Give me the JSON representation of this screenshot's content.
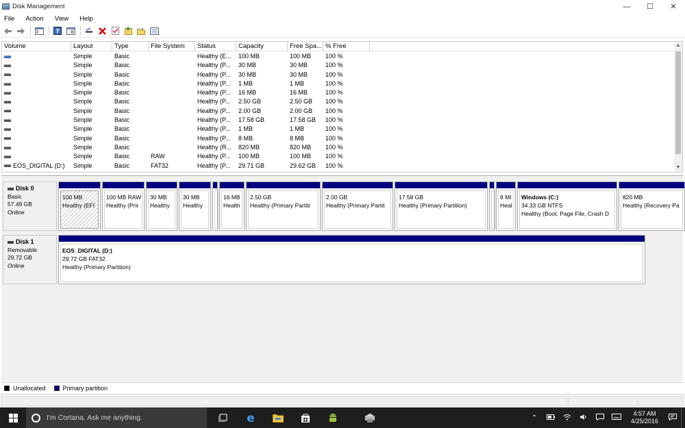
{
  "window": {
    "title": "Disk Management",
    "minimize": "—",
    "maximize": "☐",
    "close": "✕"
  },
  "menu": [
    "File",
    "Action",
    "View",
    "Help"
  ],
  "toolbar": [
    "back-icon",
    "forward-icon",
    "console-icon",
    "help-icon",
    "properties-icon",
    "connect-icon",
    "delete-icon",
    "check-icon",
    "new-icon",
    "folder-icon",
    "list-icon"
  ],
  "columns": [
    "Volume",
    "Layout",
    "Type",
    "File System",
    "Status",
    "Capacity",
    "Free Spa...",
    "% Free"
  ],
  "volumes": [
    {
      "name": "",
      "layout": "Simple",
      "type": "Basic",
      "fs": "",
      "status": "Healthy (E...",
      "capacity": "100 MB",
      "free": "100 MB",
      "pct": "100 %",
      "icon": "blue"
    },
    {
      "name": "",
      "layout": "Simple",
      "type": "Basic",
      "fs": "",
      "status": "Healthy (P...",
      "capacity": "30 MB",
      "free": "30 MB",
      "pct": "100 %",
      "icon": "gray"
    },
    {
      "name": "",
      "layout": "Simple",
      "type": "Basic",
      "fs": "",
      "status": "Healthy (P...",
      "capacity": "30 MB",
      "free": "30 MB",
      "pct": "100 %",
      "icon": "gray"
    },
    {
      "name": "",
      "layout": "Simple",
      "type": "Basic",
      "fs": "",
      "status": "Healthy (P...",
      "capacity": "1 MB",
      "free": "1 MB",
      "pct": "100 %",
      "icon": "gray"
    },
    {
      "name": "",
      "layout": "Simple",
      "type": "Basic",
      "fs": "",
      "status": "Healthy (P...",
      "capacity": "16 MB",
      "free": "16 MB",
      "pct": "100 %",
      "icon": "gray"
    },
    {
      "name": "",
      "layout": "Simple",
      "type": "Basic",
      "fs": "",
      "status": "Healthy (P...",
      "capacity": "2.50 GB",
      "free": "2.50 GB",
      "pct": "100 %",
      "icon": "gray"
    },
    {
      "name": "",
      "layout": "Simple",
      "type": "Basic",
      "fs": "",
      "status": "Healthy (P...",
      "capacity": "2.00 GB",
      "free": "2.00 GB",
      "pct": "100 %",
      "icon": "gray"
    },
    {
      "name": "",
      "layout": "Simple",
      "type": "Basic",
      "fs": "",
      "status": "Healthy (P...",
      "capacity": "17.58 GB",
      "free": "17.58 GB",
      "pct": "100 %",
      "icon": "gray"
    },
    {
      "name": "",
      "layout": "Simple",
      "type": "Basic",
      "fs": "",
      "status": "Healthy (P...",
      "capacity": "1 MB",
      "free": "1 MB",
      "pct": "100 %",
      "icon": "gray"
    },
    {
      "name": "",
      "layout": "Simple",
      "type": "Basic",
      "fs": "",
      "status": "Healthy (P...",
      "capacity": "8 MB",
      "free": "8 MB",
      "pct": "100 %",
      "icon": "gray"
    },
    {
      "name": "",
      "layout": "Simple",
      "type": "Basic",
      "fs": "",
      "status": "Healthy (R...",
      "capacity": "820 MB",
      "free": "820 MB",
      "pct": "100 %",
      "icon": "gray"
    },
    {
      "name": "",
      "layout": "Simple",
      "type": "Basic",
      "fs": "RAW",
      "status": "Healthy (P...",
      "capacity": "100 MB",
      "free": "100 MB",
      "pct": "100 %",
      "icon": "gray"
    },
    {
      "name": "EOS_DIGITAL (D:)",
      "layout": "Simple",
      "type": "Basic",
      "fs": "FAT32",
      "status": "Healthy (P...",
      "capacity": "29.71 GB",
      "free": "29.62 GB",
      "pct": "100 %",
      "icon": "gray"
    }
  ],
  "disks": [
    {
      "name": "Disk 0",
      "type": "Basic",
      "size": "57.49 GB",
      "state": "Online",
      "partitions": [
        {
          "l1": "100 MB",
          "l2": "Healthy (EFI",
          "hatch": true
        },
        {
          "l1": "100 MB RAW",
          "l2": "Healthy (Prir"
        },
        {
          "l1": "30 MB",
          "l2": "Healthy"
        },
        {
          "l1": "30 MB",
          "l2": "Healthy"
        },
        {
          "l1": "",
          "l2": ""
        },
        {
          "l1": "16 MB",
          "l2": "Health"
        },
        {
          "l1": "2.50 GB",
          "l2": "Healthy (Primary Partiti"
        },
        {
          "l1": "2.00 GB",
          "l2": "Healthy (Primary Partit"
        },
        {
          "l1": "17.58 GB",
          "l2": "Healthy (Primary Partition)"
        },
        {
          "l1": "",
          "l2": ""
        },
        {
          "l1": "8 MI",
          "l2": "Heal"
        },
        {
          "name": "Windows  (C:)",
          "l1": "34.33 GB NTFS",
          "l2": "Healthy (Boot, Page File, Crash D"
        },
        {
          "l1": "820 MB",
          "l2": "Healthy (Recovery Pa"
        }
      ]
    },
    {
      "name": "Disk 1",
      "type": "Removable",
      "size": "29.72 GB",
      "state": "Online",
      "partitions": [
        {
          "name": "EOS_DIGITAL  (D:)",
          "l1": "29.72 GB FAT32",
          "l2": "Healthy (Primary Partition)"
        }
      ]
    }
  ],
  "legend": [
    {
      "label": "Unallocated",
      "color": "#000000"
    },
    {
      "label": "Primary partition",
      "color": "#000080"
    }
  ],
  "taskbar": {
    "search_placeholder": "I'm Cortana. Ask me anything.",
    "time": "4:57 AM",
    "date": "4/25/2016"
  }
}
